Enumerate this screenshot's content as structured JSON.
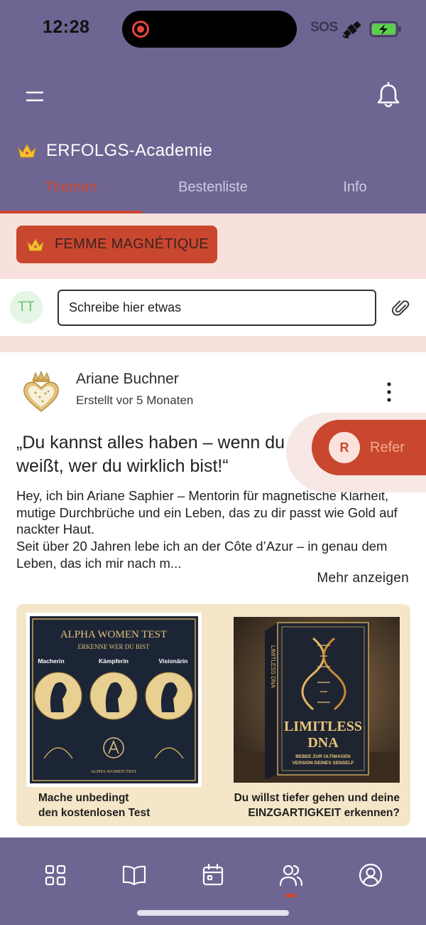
{
  "status_bar": {
    "time": "12:28",
    "sos": "SOS"
  },
  "header": {
    "group_title": "ERFOLGS-Academie",
    "tabs": [
      {
        "label": "Themen",
        "active": true
      },
      {
        "label": "Bestenliste",
        "active": false
      },
      {
        "label": "Info",
        "active": false
      }
    ]
  },
  "topic_chip": {
    "label": "FEMME MAGNÉTIQUE"
  },
  "composer": {
    "avatar_initials": "TT",
    "placeholder": "Schreibe hier etwas"
  },
  "post": {
    "author": "Ariane Buchner",
    "created": "Erstellt vor 5 Monaten",
    "title": "„Du kannst alles haben – wenn du weißt, wer du wirklich bist!“",
    "body": "Hey, ich bin Ariane Saphier – Mentorin für magnetische Klarheit, mutige Durchbrüche und ein Leben, das zu dir passt wie Gold auf nackter Haut.\nSeit über 20 Jahren lebe ich an der Côte d’Azur – in genau dem Leben, das ich mir nach m...",
    "more_label": "Mehr anzeigen",
    "media": {
      "left_book": {
        "title": "ALPHA WOMEN TEST",
        "subtitle": "ERKENNE WER DU BIST",
        "tags": [
          "Macherin",
          "Kämpferin",
          "Visionärin"
        ],
        "footer": "ALPHA WOMEN TEST"
      },
      "right_book": {
        "spine": "LIMITLESS DNA",
        "title_line1": "LIMITLESS",
        "title_line2": "DNA",
        "subtitle_line1": "BEBEE ZUR ULTIMAGEN",
        "subtitle_line2": "VERSION DEINES SENSELF"
      },
      "caption_left": "Mache unbedingt\nden kostenlosen Test",
      "caption_right": "Du willst tiefer gehen und deine\nEINZGARTIGKEIT erkennen?"
    }
  },
  "refer_fab": {
    "avatar_letter": "R",
    "label": "Refer"
  },
  "bottom_nav": {
    "items": [
      "grid-icon",
      "book-icon",
      "calendar-icon",
      "people-icon",
      "profile-icon"
    ],
    "active_index": 3
  },
  "colors": {
    "header_bg": "#6e6592",
    "accent": "#c9472f",
    "band_bg": "#f8e0dc",
    "card_bg": "#f4e6c8"
  }
}
